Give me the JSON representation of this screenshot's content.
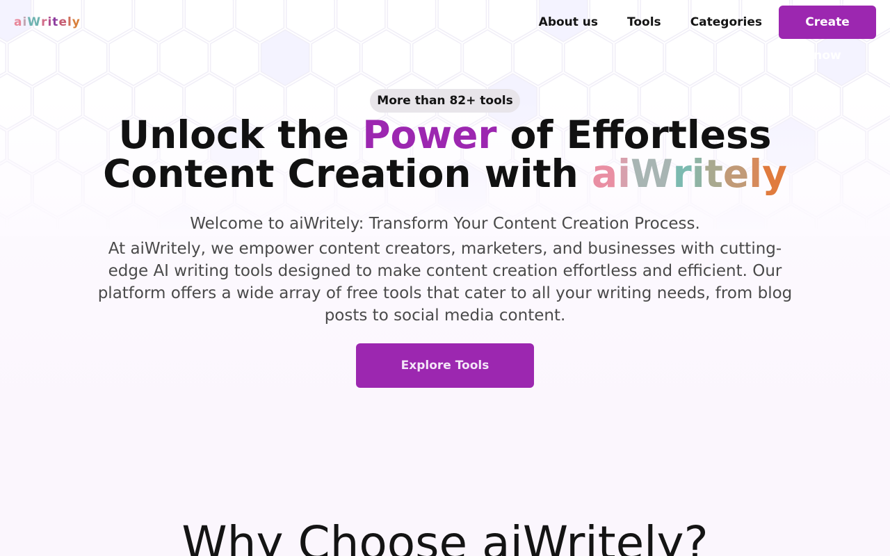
{
  "header": {
    "logo": {
      "letters": [
        "a",
        "i",
        "W",
        "r",
        "i",
        "t",
        "e",
        "l",
        "y"
      ],
      "colors": [
        "#e8879a",
        "#c2a6b3",
        "#6fb3b0",
        "#d26d8a",
        "#b04f8f",
        "#8e3ea0",
        "#c55b71",
        "#cf6f5a",
        "#d9803c"
      ]
    },
    "nav": {
      "about_label": "About us",
      "tools_label": "Tools",
      "categories_label": "Categories",
      "cta_label": "Create now"
    }
  },
  "hero": {
    "pill_label": "More than 82+ tools",
    "headline": {
      "part1": "Unlock the ",
      "accent": "Power",
      "part2": " of Effortless",
      "line2": "Content Creation with ",
      "brand_letters": [
        "a",
        "i",
        "W",
        "r",
        "i",
        "t",
        "e",
        "l",
        "y"
      ],
      "brand_colors": [
        "#e98fa3",
        "#d7a0ad",
        "#a8b5b3",
        "#7cbab0",
        "#8fb3a4",
        "#a9a98f",
        "#c19a77",
        "#d68a5b",
        "#e07b3e"
      ]
    },
    "subtitle": "Welcome to aiWritely: Transform Your Content Creation Process.",
    "description": "At aiWritely, we empower content creators, marketers, and businesses with cutting-edge AI writing tools designed to make content creation effortless and efficient. Our platform offers a wide array of free tools that cater to all your writing needs, from blog posts to social media content.",
    "explore_label": "Explore Tools"
  },
  "why_section": {
    "title": "Why Choose aiWritely?"
  },
  "colors": {
    "accent": "#9c27b0",
    "pill_bg": "#e8e5ea",
    "text": "#141414"
  }
}
